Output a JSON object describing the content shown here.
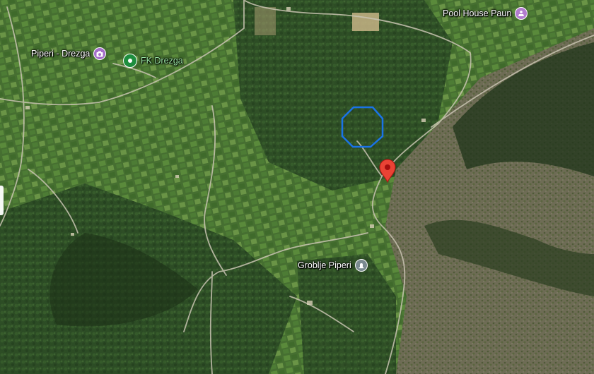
{
  "map": {
    "type": "satellite",
    "places": [
      {
        "name": "Piperi - Drezga",
        "category": "photo",
        "icon": "camera-icon",
        "color": "#a46ec9"
      },
      {
        "name": "FK Drezga",
        "category": "sports",
        "icon": "place-pin-icon",
        "color": "#1e8e3e"
      },
      {
        "name": "Pool House Paun",
        "category": "lodging",
        "icon": "hotel-icon",
        "color": "#b27ccf"
      },
      {
        "name": "Groblje Piperi",
        "category": "cemetery",
        "icon": "cemetery-icon",
        "color": "#7a8a90"
      }
    ],
    "marker": {
      "icon": "location-pin-icon",
      "color": "#ea4335"
    },
    "outline": {
      "shape": "circle",
      "color": "#1a73e8"
    }
  }
}
